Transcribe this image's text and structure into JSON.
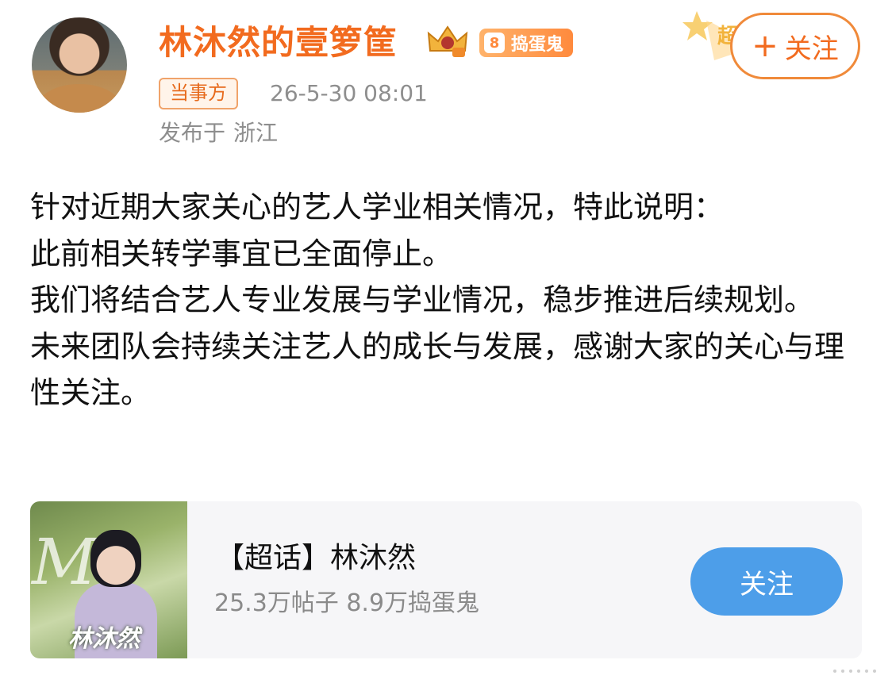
{
  "header": {
    "username": "林沐然的壹箩筐",
    "fan_badge": {
      "level": "8",
      "label": "捣蛋鬼"
    },
    "party_tag": "当事方",
    "timestamp": "26-5-30 08:01",
    "location_prefix": "发布于",
    "location": "浙江",
    "follow_label": "关注",
    "follow_plus": "+",
    "deco_char": "超"
  },
  "post": {
    "paragraphs": [
      "针对近期大家关心的艺人学业相关情况，特此说明：",
      "此前相关转学事宜已全面停止。",
      "我们将结合艺人专业发展与学业情况，稳步推进后续规划。",
      "未来团队会持续关注艺人的成长与发展，感谢大家的关心与理性关注。"
    ]
  },
  "card": {
    "title": "【超话】林沐然",
    "stats": "25.3万帖子 8.9万捣蛋鬼",
    "follow_label": "关注",
    "thumb_letter": "M",
    "thumb_name": "林沐然"
  },
  "colors": {
    "accent_orange": "#f26b1f",
    "follow_blue": "#4d9ee9",
    "meta_gray": "#8e8e8e"
  }
}
